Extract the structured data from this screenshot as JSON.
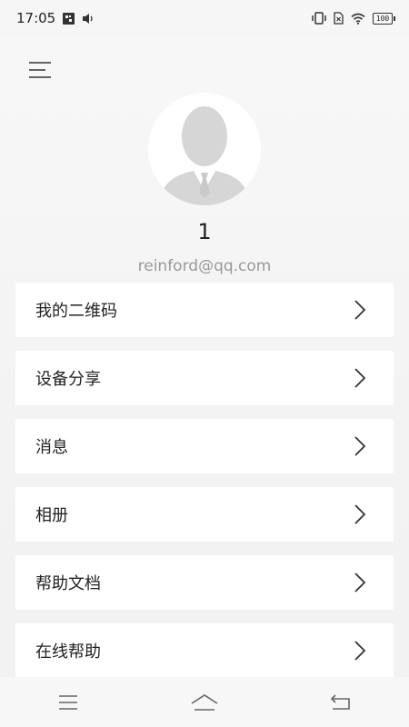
{
  "status_bar": {
    "time": "17:05",
    "battery": "100"
  },
  "profile": {
    "name": "1",
    "email": "reinford@qq.com"
  },
  "menu": [
    {
      "label": "我的二维码",
      "icon": "chevron-right-icon"
    },
    {
      "label": "设备分享",
      "icon": "chevron-right-icon"
    },
    {
      "label": "消息",
      "icon": "chevron-right-icon"
    },
    {
      "label": "相册",
      "icon": "chevron-right-icon"
    },
    {
      "label": "帮助文档",
      "icon": "chevron-right-icon"
    },
    {
      "label": "在线帮助",
      "icon": "chevron-right-icon"
    }
  ],
  "icons": {
    "menu": "hamburger-menu-icon",
    "avatar": "default-person-avatar",
    "nav": [
      "recent-apps-icon",
      "home-icon",
      "back-icon"
    ]
  },
  "colors": {
    "background": "#f2f2f2",
    "card": "#ffffff",
    "email_text": "#999999"
  }
}
